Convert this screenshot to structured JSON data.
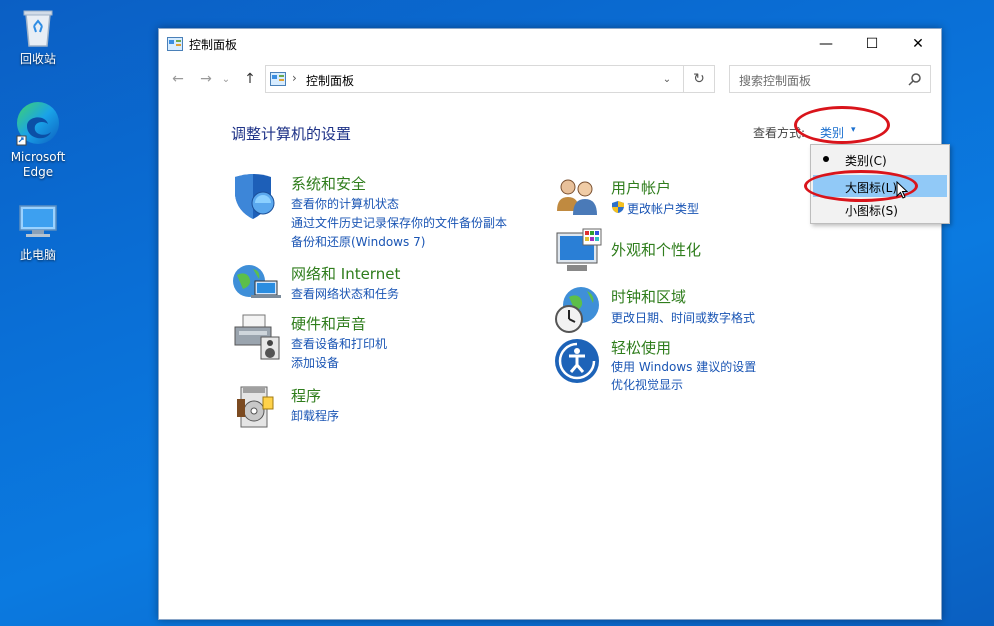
{
  "desktop": {
    "icons": [
      {
        "label": "回收站",
        "icon": "recycle-bin-icon"
      },
      {
        "label": "Microsoft Edge",
        "icon": "edge-icon"
      },
      {
        "label": "此电脑",
        "icon": "this-pc-icon"
      }
    ]
  },
  "window": {
    "title": "控制面板",
    "controls": {
      "minimize": "—",
      "maximize": "☐",
      "close": "✕"
    }
  },
  "address": {
    "path": "控制面板",
    "separator": "›",
    "back": "←",
    "forward": "→",
    "recent": "⌄",
    "up": "↑",
    "dropdown": "⌄",
    "refresh": "↻",
    "search_placeholder": "搜索控制面板"
  },
  "content": {
    "title": "调整计算机的设置",
    "view_by_label": "查看方式:",
    "view_by_value": "类别",
    "view_by_caret": "▾"
  },
  "categories": [
    {
      "name": "系统和安全",
      "icon": "shield-icon",
      "links": [
        "查看你的计算机状态",
        "通过文件历史记录保存你的文件备份副本",
        "备份和还原(Windows 7)"
      ]
    },
    {
      "name": "网络和 Internet",
      "icon": "network-globe-icon",
      "links": [
        "查看网络状态和任务"
      ]
    },
    {
      "name": "硬件和声音",
      "icon": "printer-icon",
      "links": [
        "查看设备和打印机",
        "添加设备"
      ]
    },
    {
      "name": "程序",
      "icon": "programs-icon",
      "links": [
        "卸载程序"
      ]
    },
    {
      "name": "用户帐户",
      "icon": "users-icon",
      "links": [
        "更改帐户类型"
      ]
    },
    {
      "name": "外观和个性化",
      "icon": "monitor-icon",
      "links": []
    },
    {
      "name": "时钟和区域",
      "icon": "clock-globe-icon",
      "links": [
        "更改日期、时间或数字格式"
      ]
    },
    {
      "name": "轻松使用",
      "icon": "ease-of-access-icon",
      "links": [
        "使用 Windows 建议的设置",
        "优化视觉显示"
      ]
    }
  ],
  "view_menu": {
    "items": [
      {
        "label": "类别(C)",
        "selected": true
      },
      {
        "label": "大图标(L)",
        "highlighted": true
      },
      {
        "label": "小图标(S)"
      }
    ]
  },
  "colors": {
    "category_heading": "#2f7d1c",
    "link": "#1a55b4",
    "title": "#1e3287",
    "highlight": "#91c9f7",
    "annotation": "#d9141b"
  }
}
